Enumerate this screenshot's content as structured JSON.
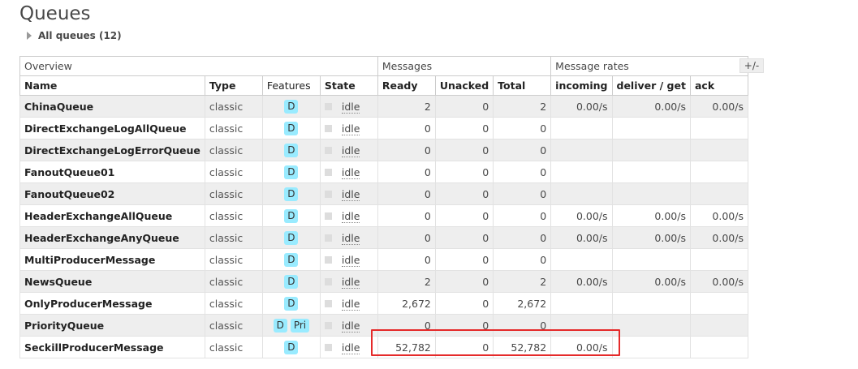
{
  "page": {
    "title": "Queues",
    "section_label": "All queues (12)",
    "toggle_columns_label": "+/-"
  },
  "table": {
    "groups": {
      "overview": "Overview",
      "messages": "Messages",
      "rates": "Message rates"
    },
    "columns": {
      "name": "Name",
      "type": "Type",
      "features": "Features",
      "state": "State",
      "ready": "Ready",
      "unacked": "Unacked",
      "total": "Total",
      "incoming": "incoming",
      "deliver": "deliver / get",
      "ack": "ack"
    },
    "rows": [
      {
        "name": "ChinaQueue",
        "type": "classic",
        "features": [
          "D"
        ],
        "state": "idle",
        "ready": "2",
        "unacked": "0",
        "total": "2",
        "incoming": "0.00/s",
        "deliver": "0.00/s",
        "ack": "0.00/s"
      },
      {
        "name": "DirectExchangeLogAllQueue",
        "type": "classic",
        "features": [
          "D"
        ],
        "state": "idle",
        "ready": "0",
        "unacked": "0",
        "total": "0",
        "incoming": "",
        "deliver": "",
        "ack": ""
      },
      {
        "name": "DirectExchangeLogErrorQueue",
        "type": "classic",
        "features": [
          "D"
        ],
        "state": "idle",
        "ready": "0",
        "unacked": "0",
        "total": "0",
        "incoming": "",
        "deliver": "",
        "ack": ""
      },
      {
        "name": "FanoutQueue01",
        "type": "classic",
        "features": [
          "D"
        ],
        "state": "idle",
        "ready": "0",
        "unacked": "0",
        "total": "0",
        "incoming": "",
        "deliver": "",
        "ack": ""
      },
      {
        "name": "FanoutQueue02",
        "type": "classic",
        "features": [
          "D"
        ],
        "state": "idle",
        "ready": "0",
        "unacked": "0",
        "total": "0",
        "incoming": "",
        "deliver": "",
        "ack": ""
      },
      {
        "name": "HeaderExchangeAllQueue",
        "type": "classic",
        "features": [
          "D"
        ],
        "state": "idle",
        "ready": "0",
        "unacked": "0",
        "total": "0",
        "incoming": "0.00/s",
        "deliver": "0.00/s",
        "ack": "0.00/s"
      },
      {
        "name": "HeaderExchangeAnyQueue",
        "type": "classic",
        "features": [
          "D"
        ],
        "state": "idle",
        "ready": "0",
        "unacked": "0",
        "total": "0",
        "incoming": "0.00/s",
        "deliver": "0.00/s",
        "ack": "0.00/s"
      },
      {
        "name": "MultiProducerMessage",
        "type": "classic",
        "features": [
          "D"
        ],
        "state": "idle",
        "ready": "0",
        "unacked": "0",
        "total": "0",
        "incoming": "",
        "deliver": "",
        "ack": ""
      },
      {
        "name": "NewsQueue",
        "type": "classic",
        "features": [
          "D"
        ],
        "state": "idle",
        "ready": "2",
        "unacked": "0",
        "total": "2",
        "incoming": "0.00/s",
        "deliver": "0.00/s",
        "ack": "0.00/s"
      },
      {
        "name": "OnlyProducerMessage",
        "type": "classic",
        "features": [
          "D"
        ],
        "state": "idle",
        "ready": "2,672",
        "unacked": "0",
        "total": "2,672",
        "incoming": "",
        "deliver": "",
        "ack": ""
      },
      {
        "name": "PriorityQueue",
        "type": "classic",
        "features": [
          "D",
          "Pri"
        ],
        "state": "idle",
        "ready": "0",
        "unacked": "0",
        "total": "0",
        "incoming": "",
        "deliver": "",
        "ack": ""
      },
      {
        "name": "SeckillProducerMessage",
        "type": "classic",
        "features": [
          "D"
        ],
        "state": "idle",
        "ready": "52,782",
        "unacked": "0",
        "total": "52,782",
        "incoming": "0.00/s",
        "deliver": "",
        "ack": ""
      }
    ]
  },
  "colors": {
    "badge": "#99ebff",
    "highlight": "#e52a2a",
    "row_alt": "#eeeeee"
  }
}
